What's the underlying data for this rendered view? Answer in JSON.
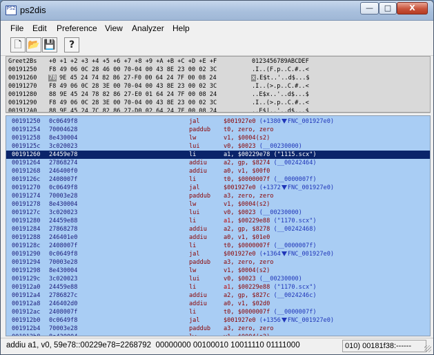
{
  "window": {
    "title": "ps2dis",
    "icon_text": "PS2",
    "buttons": {
      "minimize": "—",
      "maximize": "□",
      "close": "X"
    }
  },
  "menu": [
    "File",
    "Edit",
    "Preference",
    "View",
    "Analyzer",
    "Help"
  ],
  "toolbar": [
    {
      "name": "new-file-icon",
      "glyph": "🗋"
    },
    {
      "name": "open-folder-icon",
      "glyph": "📂"
    },
    {
      "name": "save-disk-icon",
      "glyph": "💾"
    },
    {
      "name": "help-question-icon",
      "glyph": "?"
    }
  ],
  "hex_view": {
    "header": {
      "label": "Greet2Bs",
      "offsets": "+0 +1 +2 +3 +4 +5 +6 +7 +8 +9 +A +B +C +D +E +F",
      "ascii": "0123456789ABCDEF"
    },
    "rows": [
      {
        "addr": "00191250",
        "bytes_pre": "",
        "sel": "",
        "bytes": "F8 49 06 0C 28 46 00 70-04 00 43 8E 23 00 02 3C",
        "ascii_sel": "",
        "ascii": ".I..(F.p..C.#..<"
      },
      {
        "addr": "00191260",
        "bytes_pre": "",
        "sel": "78",
        "bytes": "9E 45 24 74 82 86 27-F0 00 64 24 7F 00 08 24",
        "ascii_sel": "x",
        "ascii": ".E$t..'..d$...$"
      },
      {
        "addr": "00191270",
        "bytes_pre": "",
        "sel": "",
        "bytes": "F8 49 06 0C 28 3E 00 70-04 00 43 8E 23 00 02 3C",
        "ascii_sel": "",
        "ascii": ".I..(>.p..C.#..<"
      },
      {
        "addr": "00191280",
        "bytes_pre": "",
        "sel": "",
        "bytes": "88 9E 45 24 78 82 86 27-E0 01 64 24 7F 00 08 24",
        "ascii_sel": "",
        "ascii": "..E$x..'..d$...$"
      },
      {
        "addr": "00191290",
        "bytes_pre": "",
        "sel": "",
        "bytes": "F8 49 06 0C 28 3E 00 70-04 00 43 8E 23 00 02 3C",
        "ascii_sel": "",
        "ascii": ".I..(>.p..C.#..<"
      },
      {
        "addr": "001912A0",
        "bytes_pre": "",
        "sel": "",
        "bytes": "88 9E 45 24 7C 82 86 27-D0 02 64 24 7F 00 08 24",
        "ascii_sel": "",
        "ascii": "..E$|..'..d$...$"
      }
    ]
  },
  "disassembly": [
    {
      "addr": "00191250",
      "hex": "0c0649f8",
      "mn": "jal",
      "op": "$001927e0",
      "reg": "",
      "cmt": "(+1380",
      "arrow": true,
      "tail": "FNC_001927e0)",
      "sel": false
    },
    {
      "addr": "00191254",
      "hex": "70004628",
      "mn": "paddub",
      "op": "t0, zero, zero",
      "reg": "",
      "cmt": "",
      "arrow": false,
      "tail": "",
      "sel": false
    },
    {
      "addr": "00191258",
      "hex": "8e430004",
      "mn": "lw",
      "op": "v1, $0004(s2)",
      "reg": "",
      "cmt": "",
      "arrow": false,
      "tail": "",
      "sel": false
    },
    {
      "addr": "0019125c",
      "hex": "3c020023",
      "mn": "lui",
      "op": "v0, $0023",
      "reg": "",
      "cmt": "(__00230000)",
      "arrow": false,
      "tail": "",
      "sel": false
    },
    {
      "addr": "00191260",
      "hex": "24459e78",
      "mn": "li",
      "op": "a1, $00229e78",
      "reg": "",
      "cmt": "(\"1115.scx\")",
      "arrow": false,
      "tail": "",
      "sel": true
    },
    {
      "addr": "00191264",
      "hex": "27868274",
      "mn": "addiu",
      "op": "a2, gp, $8274",
      "reg": "",
      "cmt": "(__00242464)",
      "arrow": false,
      "tail": "",
      "sel": false
    },
    {
      "addr": "00191268",
      "hex": "246400f0",
      "mn": "addiu",
      "op": "a0, v1, $00f0",
      "reg": "",
      "cmt": "",
      "arrow": false,
      "tail": "",
      "sel": false
    },
    {
      "addr": "0019126c",
      "hex": "2408007f",
      "mn": "li",
      "op": "t0, $0000007f",
      "reg": "",
      "cmt": "(__0000007f)",
      "arrow": false,
      "tail": "",
      "sel": false
    },
    {
      "addr": "00191270",
      "hex": "0c0649f8",
      "mn": "jal",
      "op": "$001927e0",
      "reg": "",
      "cmt": "(+1372",
      "arrow": true,
      "tail": "FNC_001927e0)",
      "sel": false
    },
    {
      "addr": "00191274",
      "hex": "70003e28",
      "mn": "paddub",
      "op": "a3, zero, zero",
      "reg": "",
      "cmt": "",
      "arrow": false,
      "tail": "",
      "sel": false
    },
    {
      "addr": "00191278",
      "hex": "8e430004",
      "mn": "lw",
      "op": "v1, $0004(s2)",
      "reg": "",
      "cmt": "",
      "arrow": false,
      "tail": "",
      "sel": false
    },
    {
      "addr": "0019127c",
      "hex": "3c020023",
      "mn": "lui",
      "op": "v0, $0023",
      "reg": "",
      "cmt": "(__00230000)",
      "arrow": false,
      "tail": "",
      "sel": false
    },
    {
      "addr": "00191280",
      "hex": "24459e88",
      "mn": "li",
      "op": ", $00229e88",
      "reg": "a1",
      "cmt": "(\"1170.scx\")",
      "arrow": false,
      "tail": "",
      "sel": false
    },
    {
      "addr": "00191284",
      "hex": "27868278",
      "mn": "addiu",
      "op": "a2, gp, $8278",
      "reg": "",
      "cmt": "(__00242468)",
      "arrow": false,
      "tail": "",
      "sel": false
    },
    {
      "addr": "00191288",
      "hex": "246401e0",
      "mn": "addiu",
      "op": "a0, v1, $01e0",
      "reg": "",
      "cmt": "",
      "arrow": false,
      "tail": "",
      "sel": false
    },
    {
      "addr": "0019128c",
      "hex": "2408007f",
      "mn": "li",
      "op": "t0, $0000007f",
      "reg": "",
      "cmt": "(__0000007f)",
      "arrow": false,
      "tail": "",
      "sel": false
    },
    {
      "addr": "00191290",
      "hex": "0c0649f8",
      "mn": "jal",
      "op": "$001927e0",
      "reg": "",
      "cmt": "(+1364",
      "arrow": true,
      "tail": "FNC_001927e0)",
      "sel": false
    },
    {
      "addr": "00191294",
      "hex": "70003e28",
      "mn": "paddub",
      "op": "a3, zero, zero",
      "reg": "",
      "cmt": "",
      "arrow": false,
      "tail": "",
      "sel": false
    },
    {
      "addr": "00191298",
      "hex": "8e430004",
      "mn": "lw",
      "op": "v1, $0004(s2)",
      "reg": "",
      "cmt": "",
      "arrow": false,
      "tail": "",
      "sel": false
    },
    {
      "addr": "0019129c",
      "hex": "3c020023",
      "mn": "lui",
      "op": "v0, $0023",
      "reg": "",
      "cmt": "(__00230000)",
      "arrow": false,
      "tail": "",
      "sel": false
    },
    {
      "addr": "001912a0",
      "hex": "24459e88",
      "mn": "li",
      "op": ", $00229e88",
      "reg": "a1",
      "cmt": "(\"1170.scx\")",
      "arrow": false,
      "tail": "",
      "sel": false
    },
    {
      "addr": "001912a4",
      "hex": "2786827c",
      "mn": "addiu",
      "op": "a2, gp, $827c",
      "reg": "",
      "cmt": "(__0024246c)",
      "arrow": false,
      "tail": "",
      "sel": false
    },
    {
      "addr": "001912a8",
      "hex": "246402d0",
      "mn": "addiu",
      "op": "a0, v1, $02d0",
      "reg": "",
      "cmt": "",
      "arrow": false,
      "tail": "",
      "sel": false
    },
    {
      "addr": "001912ac",
      "hex": "2408007f",
      "mn": "li",
      "op": "t0, $0000007f",
      "reg": "",
      "cmt": "(__0000007f)",
      "arrow": false,
      "tail": "",
      "sel": false
    },
    {
      "addr": "001912b0",
      "hex": "0c0649f8",
      "mn": "jal",
      "op": "$001927e0",
      "reg": "",
      "cmt": "(+1356",
      "arrow": true,
      "tail": "FNC_001927e0)",
      "sel": false
    },
    {
      "addr": "001912b4",
      "hex": "70003e28",
      "mn": "paddub",
      "op": "a3, zero, zero",
      "reg": "",
      "cmt": "",
      "arrow": false,
      "tail": "",
      "sel": false
    },
    {
      "addr": "001912b8",
      "hex": "8e430004",
      "mn": "lw",
      "op": "v1, $0004(s2)",
      "reg": "",
      "cmt": "",
      "arrow": false,
      "tail": "",
      "sel": false
    }
  ],
  "status": {
    "left": "addiu a1, v0, 59e78::00229e78=2268792  00000000 00100010 10011110 01111000",
    "right": "010) 00181f38:------"
  },
  "colors": {
    "disasm_bg": "#a9cdf4",
    "selection": "#0a246a",
    "mnemonic": "#8b0000",
    "comment": "#1f35b8"
  }
}
